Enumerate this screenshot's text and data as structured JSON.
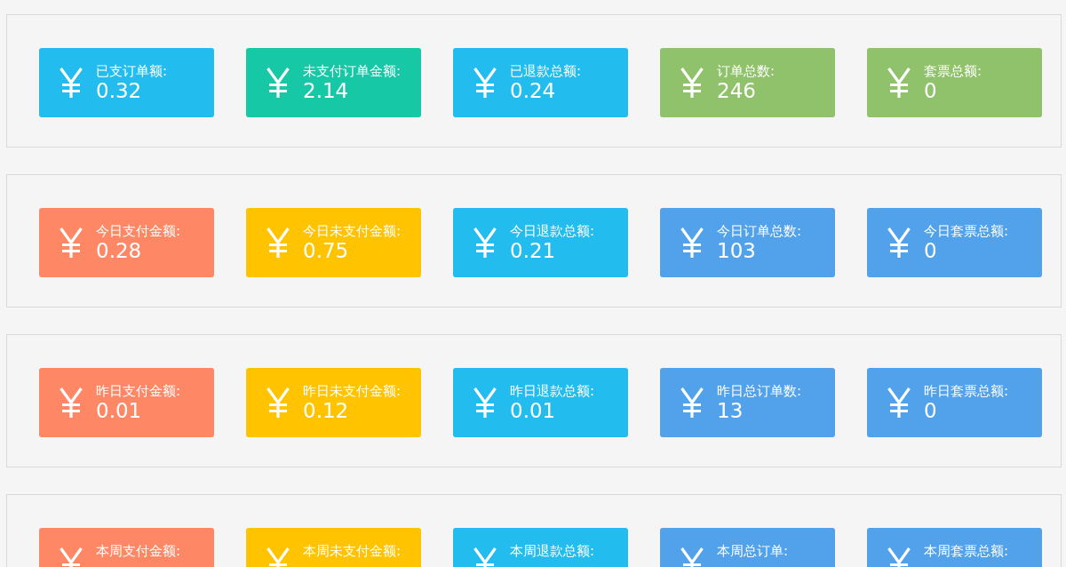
{
  "sections": [
    {
      "cards": [
        {
          "label": "已支订单额:",
          "value": "0.32",
          "color": "#22bdee"
        },
        {
          "label": "未支付订单金额:",
          "value": "2.14",
          "color": "#16c8a6"
        },
        {
          "label": "已退款总额:",
          "value": "0.24",
          "color": "#22bdee"
        },
        {
          "label": "订单总数:",
          "value": "246",
          "color": "#8fc26a"
        },
        {
          "label": "套票总额:",
          "value": "0",
          "color": "#8fc26a"
        }
      ]
    },
    {
      "cards": [
        {
          "label": "今日支付金额:",
          "value": "0.28",
          "color": "#fe8866"
        },
        {
          "label": "今日未支付金额:",
          "value": "0.75",
          "color": "#ffc300"
        },
        {
          "label": "今日退款总额:",
          "value": "0.21",
          "color": "#22bdee"
        },
        {
          "label": "今日订单总数:",
          "value": "103",
          "color": "#52a1eb"
        },
        {
          "label": "今日套票总额:",
          "value": "0",
          "color": "#52a1eb"
        }
      ]
    },
    {
      "cards": [
        {
          "label": "昨日支付金额:",
          "value": "0.01",
          "color": "#fe8866"
        },
        {
          "label": "昨日未支付金额:",
          "value": "0.12",
          "color": "#ffc300"
        },
        {
          "label": "昨日退款总额:",
          "value": "0.01",
          "color": "#22bdee"
        },
        {
          "label": "昨日总订单数:",
          "value": "13",
          "color": "#52a1eb"
        },
        {
          "label": "昨日套票总额:",
          "value": "0",
          "color": "#52a1eb"
        }
      ]
    },
    {
      "cards": [
        {
          "label": "本周支付金额:",
          "color": "#fe8866"
        },
        {
          "label": "本周未支付金额:",
          "color": "#ffc300"
        },
        {
          "label": "本周退款总额:",
          "color": "#22bdee"
        },
        {
          "label": "本周总订单:",
          "color": "#52a1eb"
        },
        {
          "label": "本周套票总额:",
          "color": "#52a1eb"
        }
      ]
    }
  ]
}
